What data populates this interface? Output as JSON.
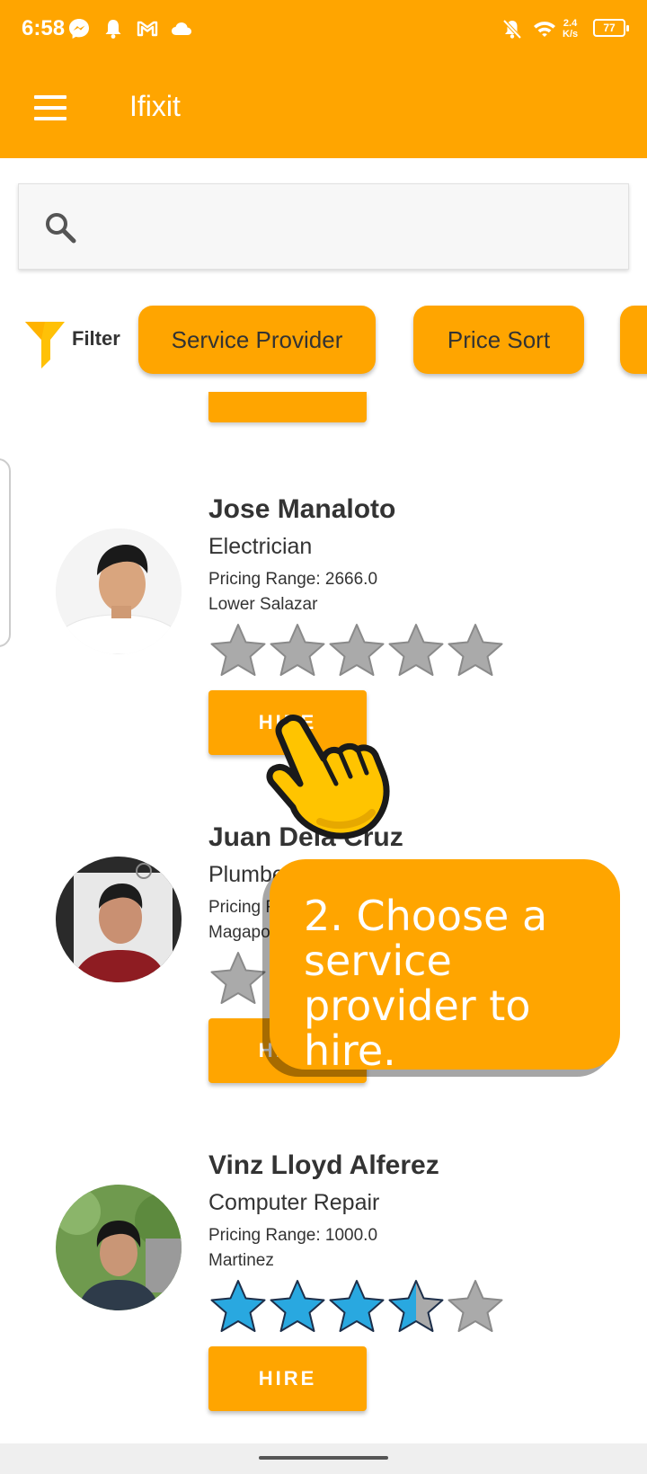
{
  "status_bar": {
    "time": "6:58",
    "net_speed_top": "2.4",
    "net_speed_bottom": "K/s",
    "battery": "77",
    "icons": [
      "messenger-icon",
      "bell-icon",
      "gmail-icon",
      "cloud-icon",
      "bell-off-icon",
      "wifi-icon",
      "battery-icon"
    ]
  },
  "appbar": {
    "title": "Ifixit",
    "menu_icon": "hamburger-menu-icon"
  },
  "search": {
    "icon": "search-icon",
    "placeholder": ""
  },
  "filters": {
    "label": "Filter",
    "icon": "funnel-icon",
    "chips": [
      "Service Provider",
      "Price Sort"
    ]
  },
  "providers": [
    {
      "name": "Jose Manaloto",
      "service": "Electrician",
      "price": "Pricing Range: 2666.0",
      "location": "Lower Salazar",
      "rating": 0,
      "hire_label": "HIRE"
    },
    {
      "name": "Juan Dela Cruz",
      "service": "Plumber",
      "price": "Pricing Range",
      "location": "Magapo",
      "rating": 0,
      "hire_label": "HIRE"
    },
    {
      "name": "Vinz Lloyd Alferez",
      "service": "Computer Repair",
      "price": "Pricing Range: 1000.0",
      "location": "Martinez",
      "rating": 3.5,
      "hire_label": "HIRE"
    }
  ],
  "tutorial": {
    "text": "2. Choose a service provider to hire.",
    "pointer_icon": "hand-pointer-icon"
  },
  "colors": {
    "accent": "#FFA500",
    "star_filled": "#29A8E0",
    "star_empty": "#AAAAAA"
  }
}
